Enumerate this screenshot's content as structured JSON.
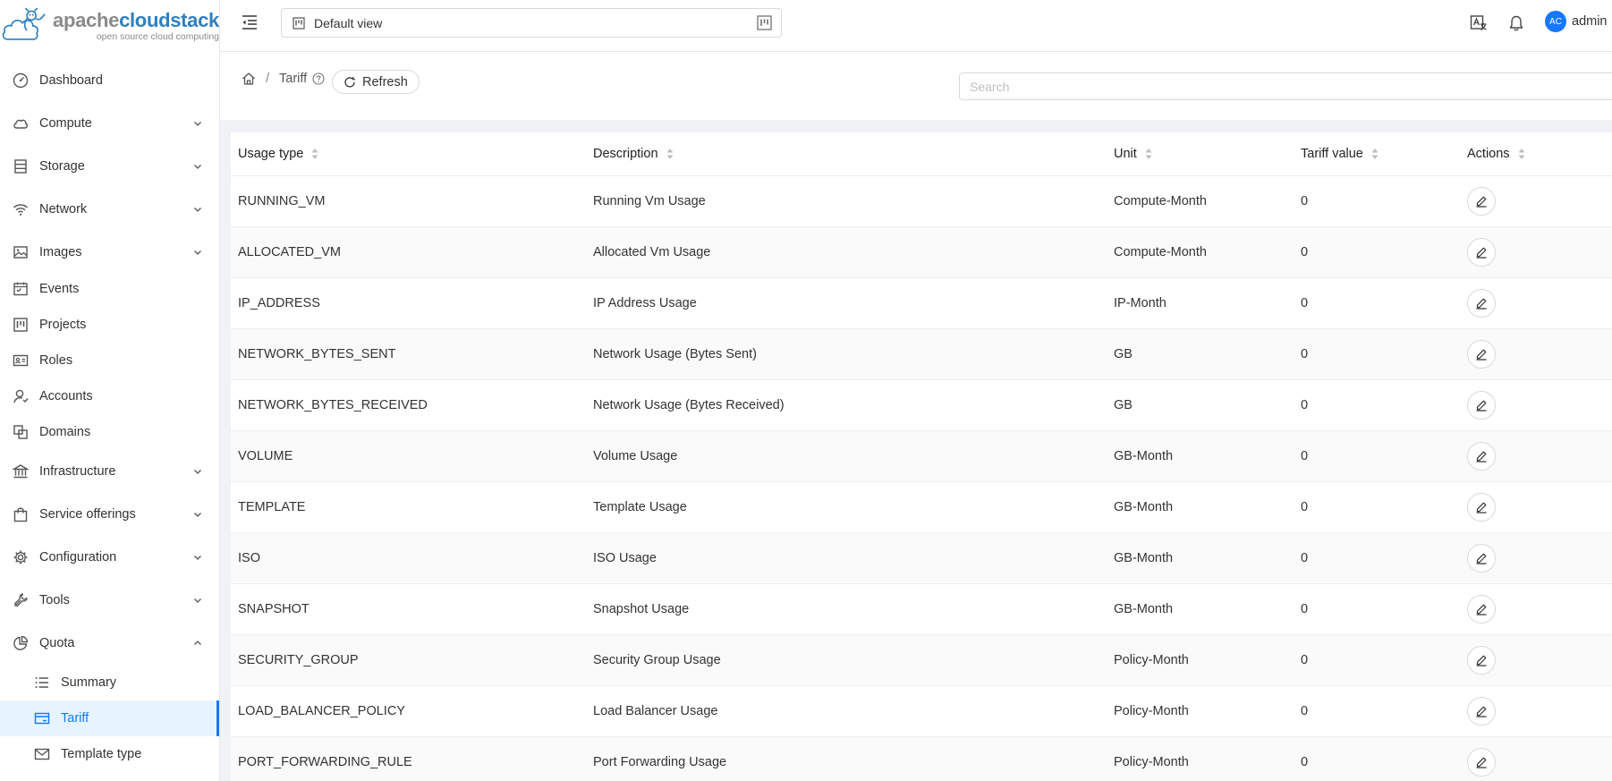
{
  "logo": {
    "brand_a": "apache",
    "brand_b": "cloudstack",
    "tagline": "open source cloud computing"
  },
  "header": {
    "view": "Default view",
    "user": {
      "initials": "AC",
      "name": "admin"
    }
  },
  "sidebar": {
    "items": [
      {
        "label": "Dashboard"
      },
      {
        "label": "Compute"
      },
      {
        "label": "Storage"
      },
      {
        "label": "Network"
      },
      {
        "label": "Images"
      },
      {
        "label": "Events"
      },
      {
        "label": "Projects"
      },
      {
        "label": "Roles"
      },
      {
        "label": "Accounts"
      },
      {
        "label": "Domains"
      },
      {
        "label": "Infrastructure"
      },
      {
        "label": "Service offerings"
      },
      {
        "label": "Configuration"
      },
      {
        "label": "Tools"
      },
      {
        "label": "Quota"
      }
    ],
    "quota_sub": [
      {
        "label": "Summary"
      },
      {
        "label": "Tariff"
      },
      {
        "label": "Template type"
      }
    ]
  },
  "page": {
    "breadcrumb": "Tariff",
    "refresh_label": "Refresh",
    "search_placeholder": "Search"
  },
  "table": {
    "columns": [
      "Usage type",
      "Description",
      "Unit",
      "Tariff value",
      "Actions"
    ],
    "rows": [
      {
        "usage_type": "RUNNING_VM",
        "description": "Running Vm Usage",
        "unit": "Compute-Month",
        "tariff": "0"
      },
      {
        "usage_type": "ALLOCATED_VM",
        "description": "Allocated Vm Usage",
        "unit": "Compute-Month",
        "tariff": "0"
      },
      {
        "usage_type": "IP_ADDRESS",
        "description": "IP Address Usage",
        "unit": "IP-Month",
        "tariff": "0"
      },
      {
        "usage_type": "NETWORK_BYTES_SENT",
        "description": "Network Usage (Bytes Sent)",
        "unit": "GB",
        "tariff": "0"
      },
      {
        "usage_type": "NETWORK_BYTES_RECEIVED",
        "description": "Network Usage (Bytes Received)",
        "unit": "GB",
        "tariff": "0"
      },
      {
        "usage_type": "VOLUME",
        "description": "Volume Usage",
        "unit": "GB-Month",
        "tariff": "0"
      },
      {
        "usage_type": "TEMPLATE",
        "description": "Template Usage",
        "unit": "GB-Month",
        "tariff": "0"
      },
      {
        "usage_type": "ISO",
        "description": "ISO Usage",
        "unit": "GB-Month",
        "tariff": "0"
      },
      {
        "usage_type": "SNAPSHOT",
        "description": "Snapshot Usage",
        "unit": "GB-Month",
        "tariff": "0"
      },
      {
        "usage_type": "SECURITY_GROUP",
        "description": "Security Group Usage",
        "unit": "Policy-Month",
        "tariff": "0"
      },
      {
        "usage_type": "LOAD_BALANCER_POLICY",
        "description": "Load Balancer Usage",
        "unit": "Policy-Month",
        "tariff": "0"
      },
      {
        "usage_type": "PORT_FORWARDING_RULE",
        "description": "Port Forwarding Usage",
        "unit": "Policy-Month",
        "tariff": "0"
      }
    ]
  },
  "colors": {
    "accent": "#1677ff",
    "active_bg": "#e6f4ff",
    "logo_blue": "#2f7fbf"
  }
}
